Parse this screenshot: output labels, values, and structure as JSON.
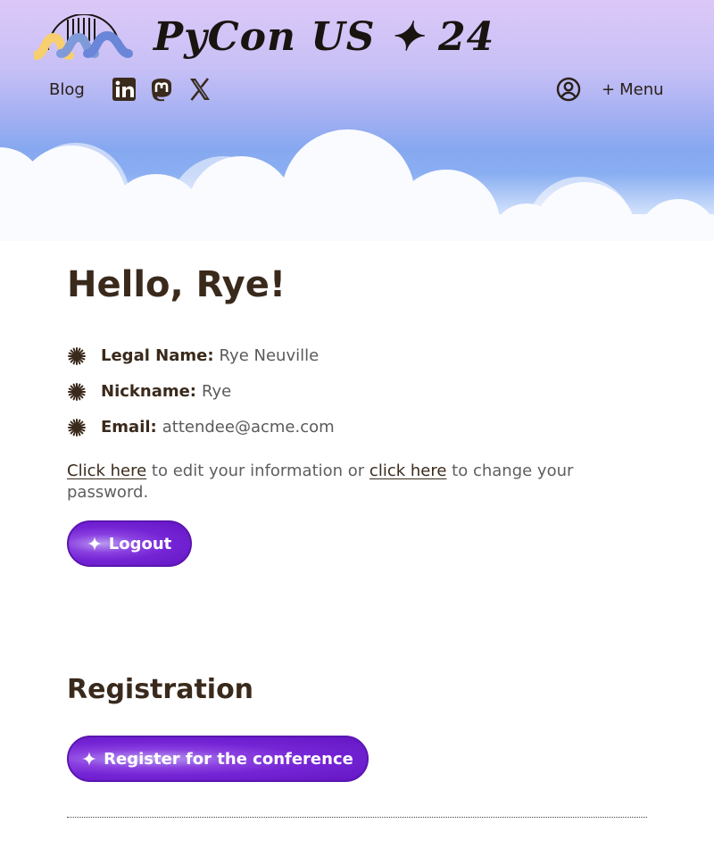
{
  "header": {
    "logo_alt": "PyCon US logo",
    "wordmark": "PyCon US ✦ 24",
    "nav_blog": "Blog",
    "social": [
      "linkedin-icon",
      "mastodon-icon",
      "x-icon"
    ],
    "menu_label": "Menu",
    "menu_plus": "+"
  },
  "profile": {
    "greeting": "Hello, Rye!",
    "fields": [
      {
        "label": "Legal Name:",
        "value": "Rye Neuville"
      },
      {
        "label": "Nickname:",
        "value": "Rye"
      },
      {
        "label": "Email:",
        "value": "attendee@acme.com"
      }
    ],
    "edit_link": "Click here",
    "edit_mid": " to edit your information or ",
    "password_link": "click here",
    "edit_end": " to change your password.",
    "logout_label": "Logout"
  },
  "registration": {
    "title": "Registration",
    "register_label": "Register for the conference"
  },
  "colors": {
    "text": "#3a2a1c",
    "muted": "#5e5e5e",
    "button": "#7424d4",
    "sky_top": "#dcc8f8",
    "sky_mid": "#86a8f0"
  }
}
